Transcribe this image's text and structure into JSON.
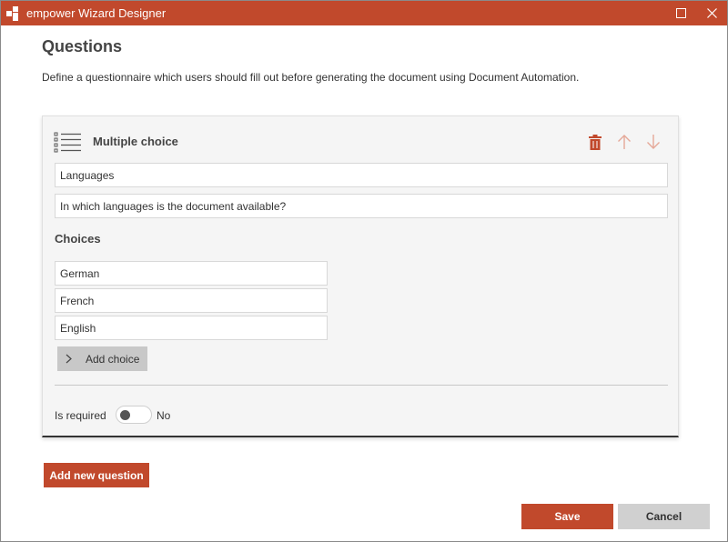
{
  "window": {
    "title": "empower Wizard Designer",
    "accent_color": "#c1492c",
    "controls": {
      "maximize_icon": "maximize-icon",
      "close_icon": "close-icon"
    }
  },
  "page": {
    "heading": "Questions",
    "description": "Define a questionnaire which users should fill out before generating the document using Document Automation."
  },
  "question": {
    "type_icon": "list-icon",
    "type_label": "Multiple choice",
    "actions": {
      "delete_icon": "trash-icon",
      "move_up_icon": "arrow-up-icon",
      "move_down_icon": "arrow-down-icon"
    },
    "title_value": "Languages",
    "text_value": "In which languages is the document available?",
    "choices_label": "Choices",
    "choices": [
      "German",
      "French",
      "English"
    ],
    "add_choice_label": "Add choice",
    "required_label": "Is required",
    "required_value": "No",
    "required_on": false
  },
  "buttons": {
    "add_question": "Add new question",
    "save": "Save",
    "cancel": "Cancel"
  }
}
